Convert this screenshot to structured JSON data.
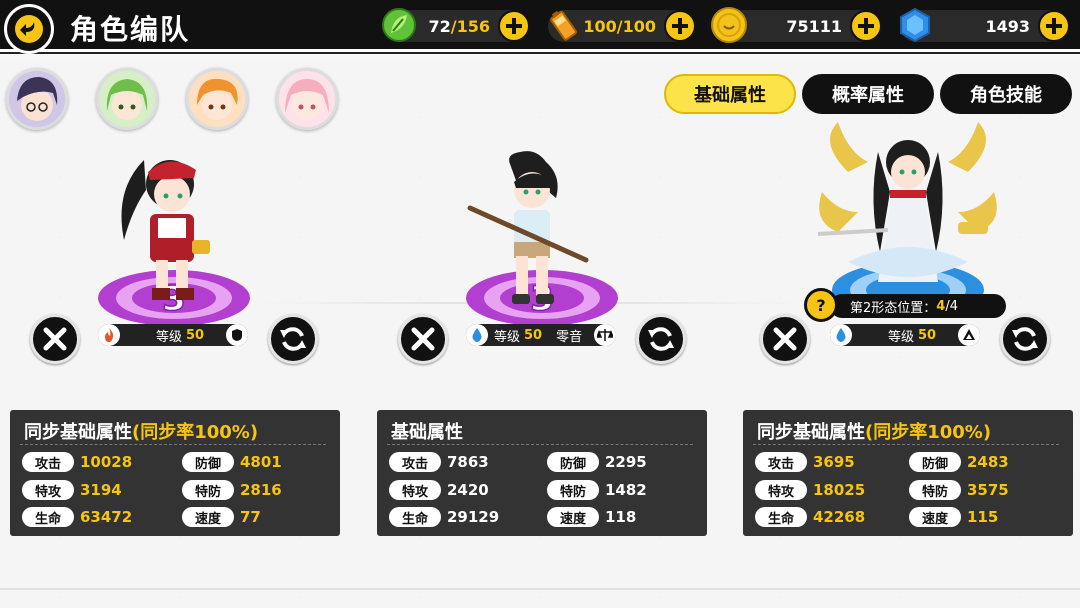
{
  "header": {
    "title": "角色编队",
    "resources": [
      {
        "name": "stamina",
        "icon": "leaf-energy-icon",
        "current": "72",
        "max": "156"
      },
      {
        "name": "battery",
        "icon": "battery-icon",
        "current": "100",
        "max": "100"
      },
      {
        "name": "coins",
        "icon": "coin-icon",
        "value": "75111"
      },
      {
        "name": "gems",
        "icon": "blue-gem-icon",
        "value": "1493"
      }
    ]
  },
  "tabs": [
    {
      "label": "基础属性",
      "active": true
    },
    {
      "label": "概率属性",
      "active": false
    },
    {
      "label": "角色技能",
      "active": false
    }
  ],
  "characters": [
    {
      "level_label": "等级",
      "level": "50",
      "element_icon": "fire-element-icon",
      "stats_title": "同步基础属性",
      "stats_title_highlight": "(同步率100%)",
      "stats": [
        {
          "label": "攻击",
          "value": "10028"
        },
        {
          "label": "防御",
          "value": "4801"
        },
        {
          "label": "特攻",
          "value": "3194"
        },
        {
          "label": "特防",
          "value": "2816"
        },
        {
          "label": "生命",
          "value": "63472"
        },
        {
          "label": "速度",
          "value": "77"
        }
      ]
    },
    {
      "level_label": "等级",
      "level": "50",
      "name": "零音",
      "element_icon": "water-element-icon",
      "stats_title": "基础属性",
      "stats_title_highlight": "",
      "stats": [
        {
          "label": "攻击",
          "value": "7863"
        },
        {
          "label": "防御",
          "value": "2295"
        },
        {
          "label": "特攻",
          "value": "2420"
        },
        {
          "label": "特防",
          "value": "1482"
        },
        {
          "label": "生命",
          "value": "29129"
        },
        {
          "label": "速度",
          "value": "118"
        }
      ]
    },
    {
      "level_label": "等级",
      "level": "50",
      "element_icon": "water-element-icon",
      "form_label": "第2形态位置：",
      "form_current": "4",
      "form_total": "/4",
      "form_help": "?",
      "stats_title": "同步基础属性",
      "stats_title_highlight": "(同步率100%)",
      "stats": [
        {
          "label": "攻击",
          "value": "3695"
        },
        {
          "label": "防御",
          "value": "2483"
        },
        {
          "label": "特攻",
          "value": "18025"
        },
        {
          "label": "特防",
          "value": "3575"
        },
        {
          "label": "生命",
          "value": "42268"
        },
        {
          "label": "速度",
          "value": "115"
        }
      ]
    }
  ],
  "platform_number": "3",
  "colors": {
    "accent_yellow": "#f5c414",
    "platform_purple": "#b23fd0",
    "platform_blue": "#2c8fe0"
  }
}
